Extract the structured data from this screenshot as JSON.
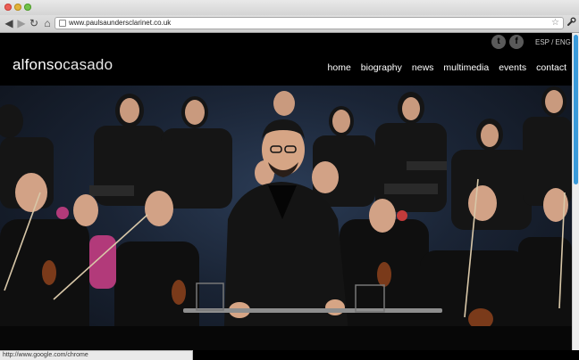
{
  "browser": {
    "url": "www.paulsaundersclarinet.co.uk",
    "status_url": "http://www.google.com/chrome",
    "nav": {
      "back": "◀",
      "forward": "▶",
      "reload": "↻",
      "home": "⌂"
    },
    "star": "☆",
    "wrench": "🔧"
  },
  "site": {
    "logo_part1": "alfonso",
    "logo_part2": "casado",
    "social": {
      "twitter": "t",
      "facebook": "f"
    },
    "lang": "ESP / ENG",
    "menu": [
      "home",
      "biography",
      "news",
      "multimedia",
      "events",
      "contact"
    ]
  },
  "hero": {
    "icons": [
      "conductor-photo"
    ],
    "colors": {
      "background": "#1a2435",
      "stage": "#0a0a0a",
      "highlight": "#3a9ad9"
    }
  }
}
